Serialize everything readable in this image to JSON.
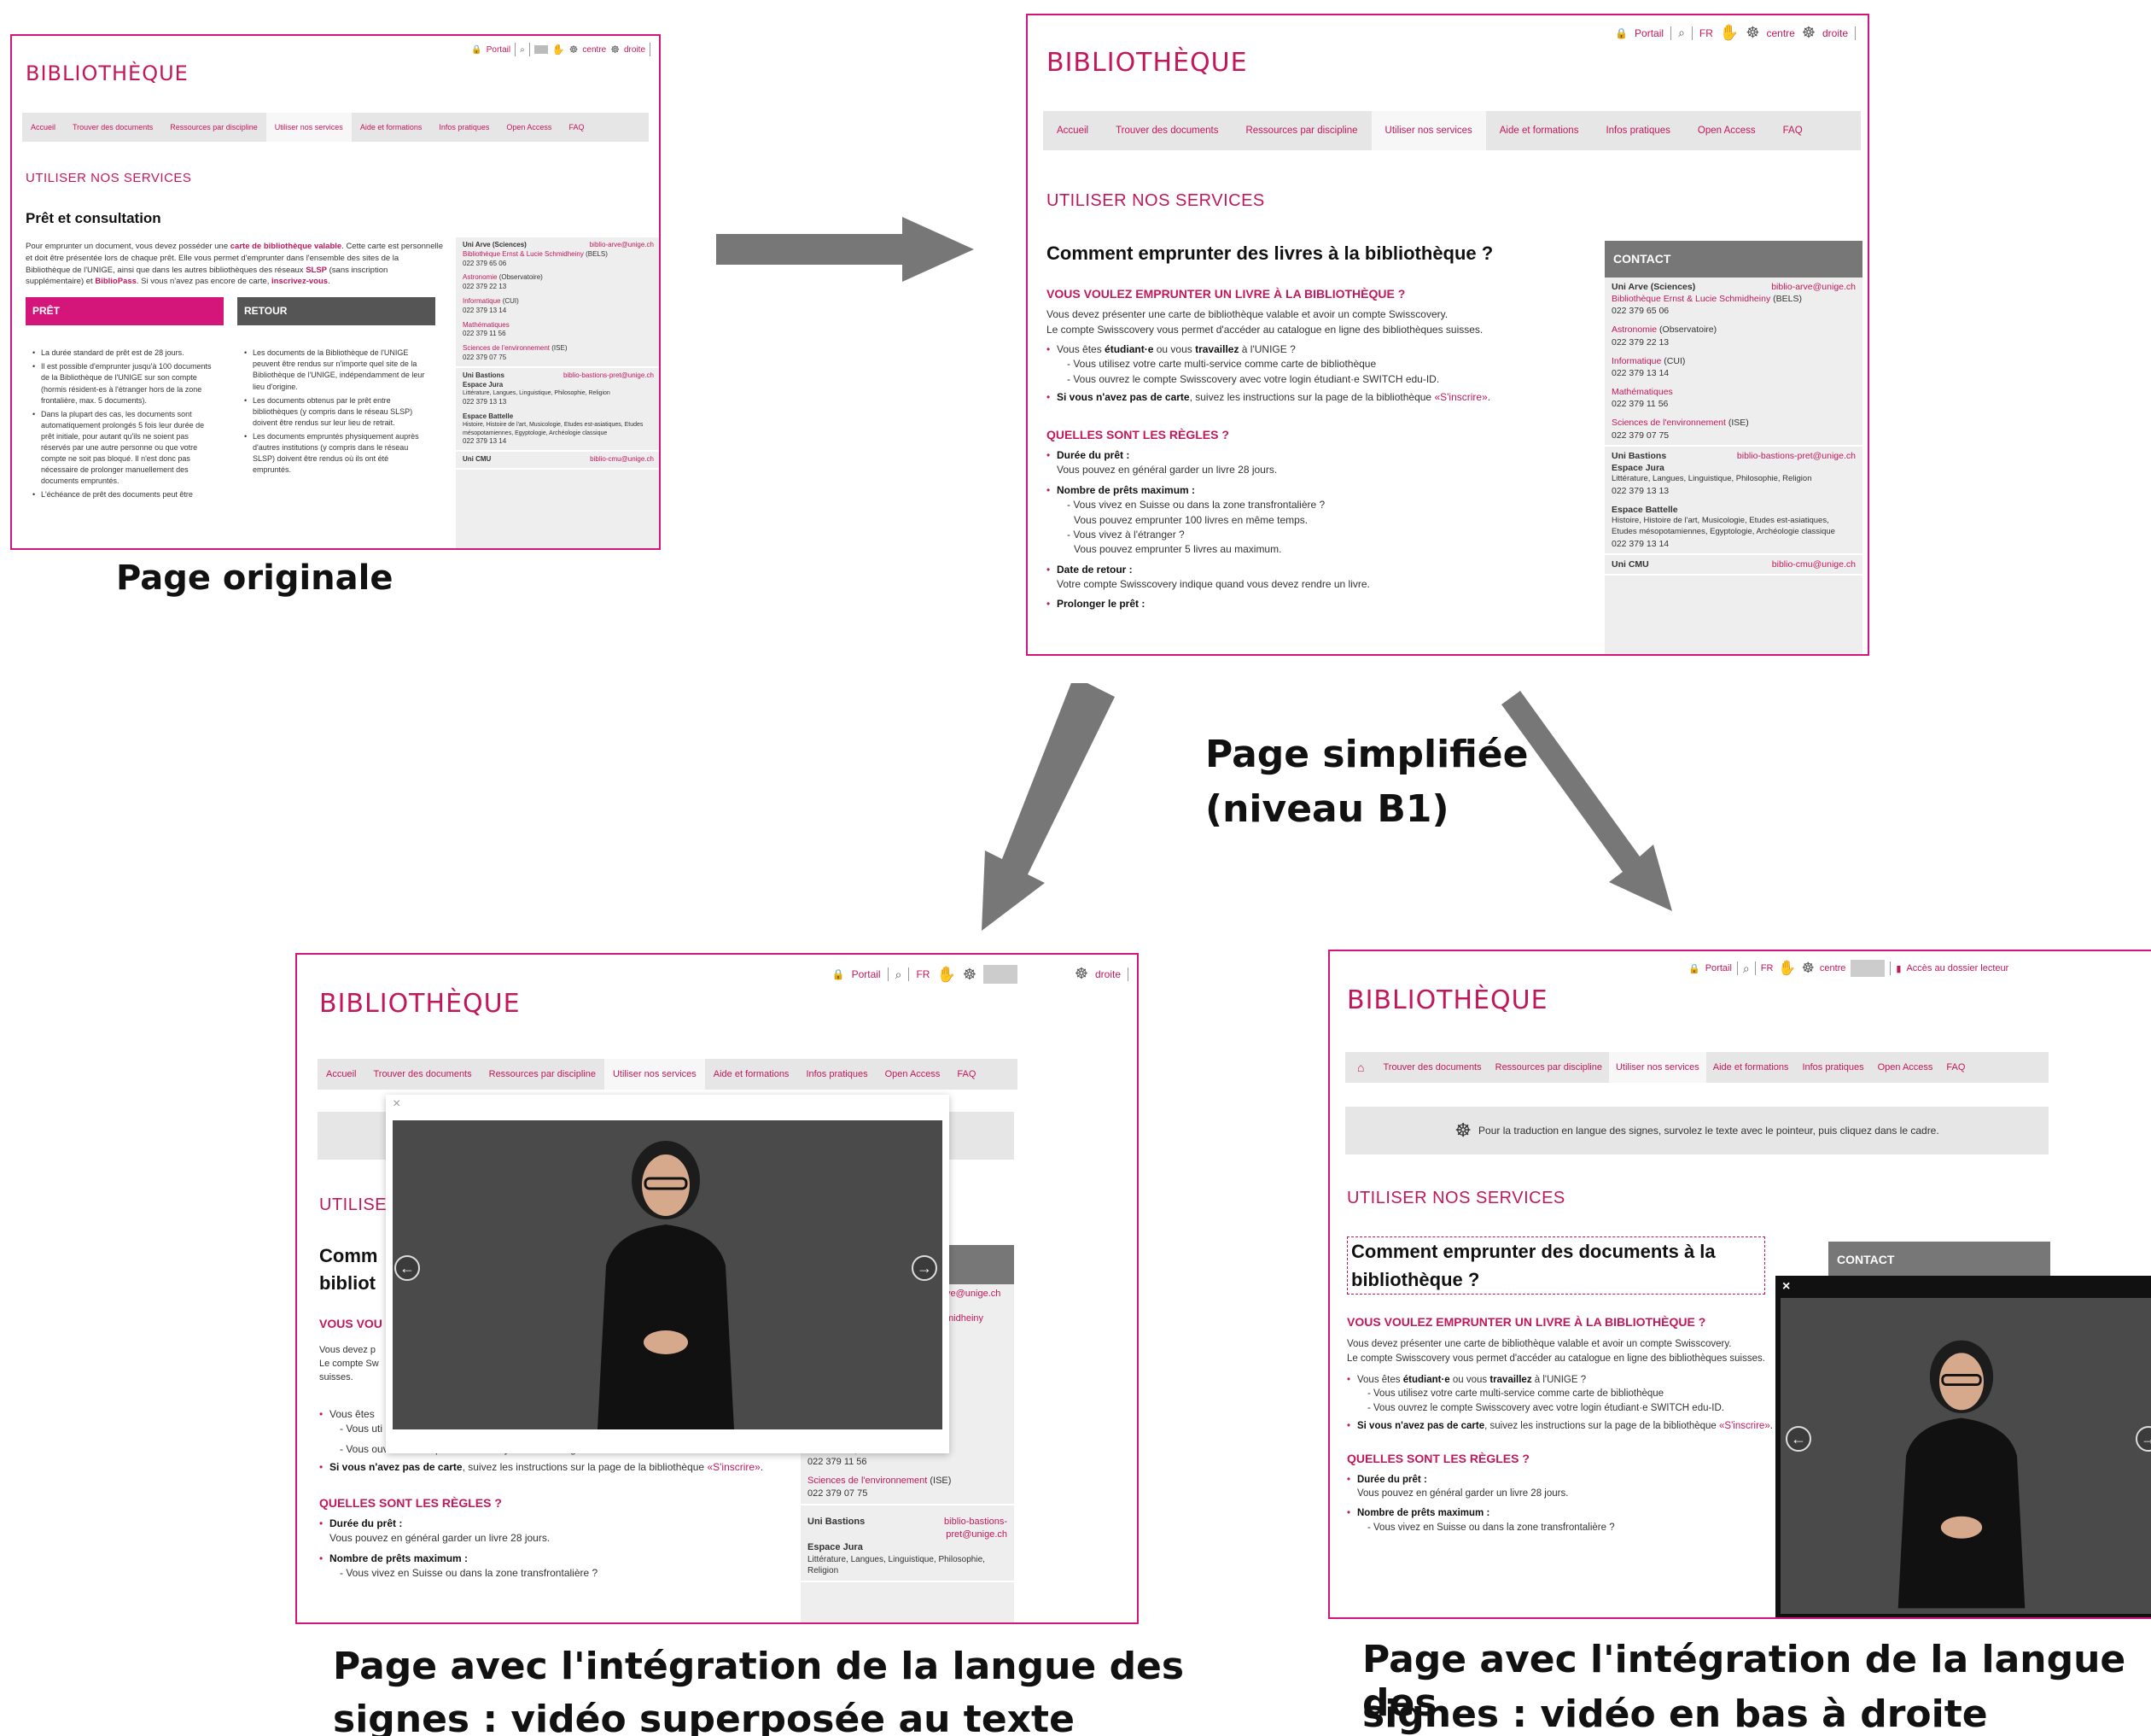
{
  "common": {
    "brand": "BIBLIOTHÈQUE",
    "util": {
      "portail": "Portail",
      "search": "🔍",
      "lang": "FR",
      "centre": "centre",
      "droite": "droite",
      "dossier": "Accès au dossier lecteur"
    },
    "nav": [
      "Accueil",
      "Trouver des documents",
      "Ressources par discipline",
      "Utiliser nos services",
      "Aide et formations",
      "Infos pratiques",
      "Open Access",
      "FAQ"
    ],
    "section": "UTILISER NOS SERVICES"
  },
  "original": {
    "caption": "Page originale",
    "title": "Prêt et consultation",
    "intro_1": "Pour emprunter un document, vous devez posséder une ",
    "intro_link_1": "carte de bibliothèque valable",
    "intro_2": ". Cette carte est personnelle et doit être présentée lors de chaque prêt. Elle vous permet d'emprunter dans l'ensemble des sites de la Bibliothèque de l'UNIGE, ainsi que dans les autres bibliothèques des réseaux ",
    "intro_slsp": "SLSP",
    "intro_3": " (sans inscription supplémentaire) et ",
    "intro_bibliopass": "BiblioPass",
    "intro_4": ". Si vous n'avez pas encore de carte, ",
    "intro_link_2": "inscrivez-vous",
    "intro_5": ".",
    "pret_head": "PRÊT",
    "pret_items": [
      "La durée standard de prêt est de 28 jours.",
      "Il est possible d'emprunter jusqu'à 100 documents de la Bibliothèque de l'UNIGE sur son compte (hormis résident-es à l'étranger hors de la zone frontalière, max. 5 documents).",
      "Dans la plupart des cas, les documents sont automatiquement prolongés 5 fois leur durée de prêt initiale, pour autant qu'ils ne soient pas réservés par une autre personne ou que votre compte ne soit pas bloqué. Il n'est donc pas nécessaire de prolonger manuellement des documents empruntés.",
      "L'échéance de prêt des documents peut être"
    ],
    "retour_head": "RETOUR",
    "retour_items": [
      "Les documents de la Bibliothèque de l'UNIGE peuvent être rendus sur n'importe quel site de la Bibliothèque de l'UNIGE, indépendamment de leur lieu d'origine.",
      "Les documents obtenus par le prêt entre bibliothèques (y compris dans le réseau SLSP) doivent être rendus sur leur lieu de retrait.",
      "Les documents empruntés physiquement auprès d'autres institutions (y compris dans le réseau SLSP) doivent être rendus où ils ont été empruntés."
    ]
  },
  "contact": {
    "head": "CONTACT",
    "arve_name": "Uni Arve (Sciences)",
    "arve_mail": "biblio-arve@unige.ch",
    "arve_lines": [
      {
        "link": "Bibliothèque Ernst & Lucie Schmidheiny",
        "rest": " (BELS)",
        "tel": "022 379 65 06"
      },
      {
        "link": "Astronomie",
        "rest": " (Observatoire)",
        "tel": "022 379 22 13"
      },
      {
        "link": "Informatique",
        "rest": " (CUI)",
        "tel": "022 379 13 14"
      },
      {
        "link": "Mathématiques",
        "rest": "",
        "tel": "022 379 11 56"
      },
      {
        "link": "Sciences de l'environnement",
        "rest": " (ISE)",
        "tel": "022 379 07 75"
      }
    ],
    "bastions_name": "Uni Bastions",
    "bastions_mail": "biblio-bastions-pret@unige.ch",
    "jura_name": "Espace Jura",
    "jura_desc": "Littérature, Langues, Linguistique, Philosophie, Religion",
    "jura_tel": "022 379 13 13",
    "battelle_name": "Espace Battelle",
    "battelle_desc": "Histoire, Histoire de l'art, Musicologie, Etudes est-asiatiques, Etudes mésopotamiennes, Egyptologie, Archéologie classique",
    "battelle_tel": "022 379 13 14",
    "cmu_name": "Uni CMU",
    "cmu_mail": "biblio-cmu@unige.ch"
  },
  "simplified": {
    "caption_1": "Page simplifiée",
    "caption_2": "(niveau B1)",
    "title": "Comment emprunter des livres à la bibliothèque ?",
    "q1": "VOUS VOULEZ EMPRUNTER UN LIVRE À LA BIBLIOTHÈQUE ?",
    "p1": "Vous devez présenter une carte de bibliothèque valable et avoir un compte Swisscovery.",
    "p2": "Le compte Swisscovery vous permet d'accéder au catalogue en ligne des bibliothèques suisses.",
    "b1_pre": "Vous êtes ",
    "b1_a": "étudiant·e",
    "b1_mid": " ou vous ",
    "b1_b": "travaillez",
    "b1_post": " à l'UNIGE ?",
    "b1_s1": "- Vous utilisez votre carte multi-service comme carte de bibliothèque",
    "b1_s2": "- Vous ouvrez le compte Swisscovery avec votre login étudiant·e SWITCH edu-ID.",
    "b2_bold": "Si vous n'avez pas de carte",
    "b2_rest": ", suivez les instructions sur la page de la bibliothèque ",
    "b2_link": "«S'inscrire»",
    "b2_end": ".",
    "q2": "QUELLES SONT LES RÈGLES ?",
    "r1": "Durée du prêt :",
    "r1_t": "Vous pouvez en général garder un livre 28 jours.",
    "r2": "Nombre de prêts maximum :",
    "r2_s1": "- Vous vivez en Suisse ou dans la zone transfrontalière ?",
    "r2_s2": "Vous pouvez emprunter 100 livres en même temps.",
    "r2_s3": "- Vous vivez à l'étranger ?",
    "r2_s4": "Vous pouvez emprunter 5 livres au maximum.",
    "r3": "Date de retour :",
    "r3_t": "Votre compte Swisscovery indique quand vous devez rendre un livre.",
    "r4": "Prolonger le prêt :"
  },
  "overlay": {
    "caption_1": "Page avec l'intégration de la langue des",
    "caption_2": "signes : vidéo superposée au texte",
    "close": "×",
    "title_a": "Comm",
    "title_b": "bibliot",
    "q1_frag": "VOUS VOU",
    "p_frag_1": "Vous devez p",
    "p_frag_2": "Le compte Sw",
    "p_frag_3": "suisses.",
    "b_frag_1": "Vous êtes ",
    "b_frag_2": "- Vous uti",
    "contact_frag_1": "ve@unige.ch",
    "contact_frag_2": "midheiny",
    "arrow_left": "←",
    "arrow_right": "→"
  },
  "corner": {
    "caption_1": "Page avec l'intégration de la langue des",
    "caption_2": "signes : vidéo en bas à droite",
    "signbar": "Pour la traduction en langue des signes, survolez le texte avec le pointeur, puis cliquez dans le cadre.",
    "title": "Comment emprunter des documents à la bibliothèque ?",
    "close": "×",
    "arrow_left": "←",
    "arrow_right": "→"
  }
}
